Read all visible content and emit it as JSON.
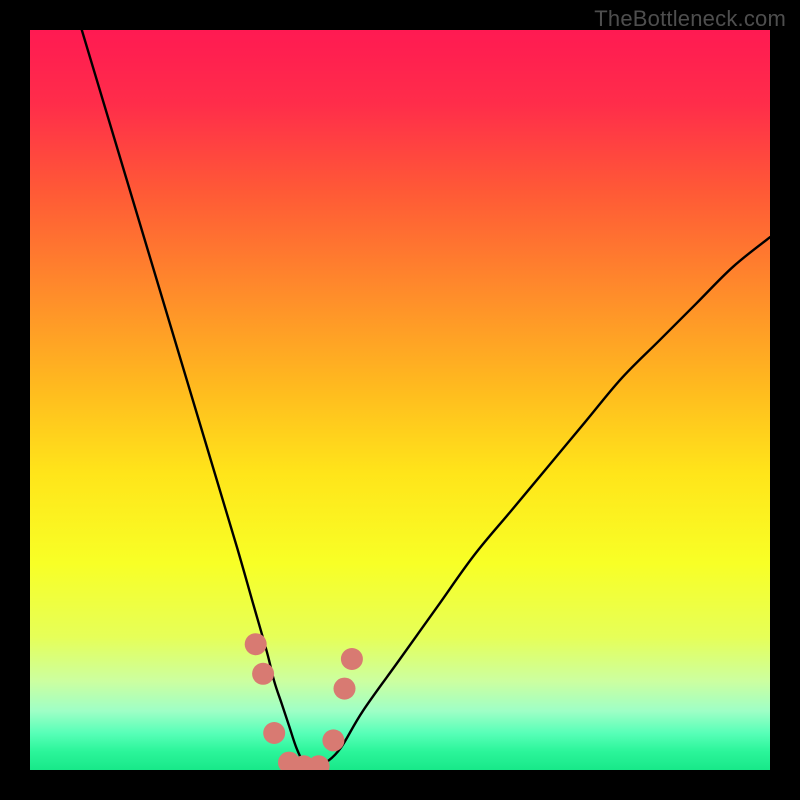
{
  "watermark": "TheBottleneck.com",
  "chart_data": {
    "type": "line",
    "title": "",
    "xlabel": "",
    "ylabel": "",
    "xlim": [
      0,
      100
    ],
    "ylim": [
      0,
      100
    ],
    "grid": false,
    "legend": false,
    "series": [
      {
        "name": "bottleneck-curve",
        "color": "#000000",
        "x": [
          7,
          10,
          13,
          16,
          19,
          22,
          25,
          28,
          30,
          32,
          33,
          34,
          35,
          36,
          37,
          38,
          39,
          40,
          42,
          45,
          50,
          55,
          60,
          65,
          70,
          75,
          80,
          85,
          90,
          95,
          100
        ],
        "values": [
          100,
          90,
          80,
          70,
          60,
          50,
          40,
          30,
          23,
          16,
          12,
          9,
          6,
          3,
          1,
          0.5,
          0.5,
          1,
          3,
          8,
          15,
          22,
          29,
          35,
          41,
          47,
          53,
          58,
          63,
          68,
          72
        ]
      },
      {
        "name": "highlight-dots",
        "color": "#d87a72",
        "type": "scatter",
        "x": [
          30.5,
          31.5,
          33,
          35,
          37,
          39,
          41,
          42.5,
          43.5
        ],
        "values": [
          17,
          13,
          5,
          1,
          0.5,
          0.5,
          4,
          11,
          15
        ]
      }
    ],
    "background_gradient": {
      "stops": [
        {
          "offset": 0.0,
          "color": "#ff1a52"
        },
        {
          "offset": 0.1,
          "color": "#ff2d4a"
        },
        {
          "offset": 0.22,
          "color": "#ff5a36"
        },
        {
          "offset": 0.35,
          "color": "#ff8a2b"
        },
        {
          "offset": 0.48,
          "color": "#ffb91f"
        },
        {
          "offset": 0.6,
          "color": "#ffe51a"
        },
        {
          "offset": 0.72,
          "color": "#f8ff26"
        },
        {
          "offset": 0.82,
          "color": "#e6ff58"
        },
        {
          "offset": 0.88,
          "color": "#ccffa0"
        },
        {
          "offset": 0.92,
          "color": "#9fffc6"
        },
        {
          "offset": 0.95,
          "color": "#58ffb8"
        },
        {
          "offset": 0.975,
          "color": "#2bf59a"
        },
        {
          "offset": 1.0,
          "color": "#18e889"
        }
      ]
    }
  }
}
